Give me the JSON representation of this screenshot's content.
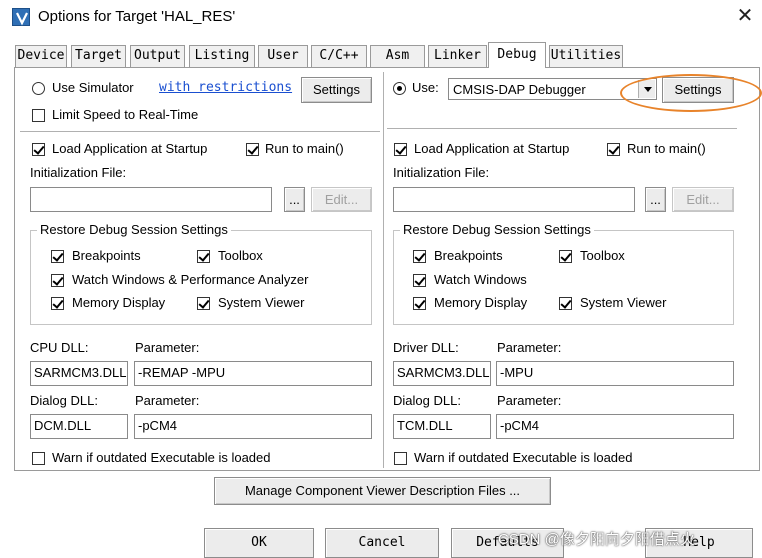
{
  "window": {
    "title": "Options for Target 'HAL_RES'",
    "close_glyph": "✕"
  },
  "tabs": [
    {
      "label": "Device",
      "active": false
    },
    {
      "label": "Target",
      "active": false
    },
    {
      "label": "Output",
      "active": false
    },
    {
      "label": "Listing",
      "active": false
    },
    {
      "label": "User",
      "active": false
    },
    {
      "label": "C/C++",
      "active": false
    },
    {
      "label": "Asm",
      "active": false
    },
    {
      "label": "Linker",
      "active": false
    },
    {
      "label": "Debug",
      "active": true
    },
    {
      "label": "Utilities",
      "active": false
    }
  ],
  "left": {
    "use_simulator_label": "Use Simulator",
    "use_simulator_selected": false,
    "restrictions_link": "with restrictions",
    "settings_label": "Settings",
    "limit_speed_label": "Limit Speed to Real-Time",
    "limit_speed_checked": false,
    "load_app_label": "Load Application at Startup",
    "load_app_checked": true,
    "run_to_main_label": "Run to main()",
    "run_to_main_checked": true,
    "init_file_label": "Initialization File:",
    "init_file_value": "",
    "browse_label": "...",
    "edit_label": "Edit...",
    "restore_group_title": "Restore Debug Session Settings",
    "breakpoints_label": "Breakpoints",
    "toolbox_label": "Toolbox",
    "watch_label": "Watch Windows & Performance Analyzer",
    "memory_label": "Memory Display",
    "sysviewer_label": "System Viewer",
    "dll_label": "CPU DLL:",
    "dll_param_label": "Parameter:",
    "dll_value": "SARMCM3.DLL",
    "dll_param_value": "-REMAP -MPU",
    "dialog_dll_label": "Dialog DLL:",
    "dialog_param_label": "Parameter:",
    "dialog_dll_value": "DCM.DLL",
    "dialog_param_value": "-pCM4",
    "warn_label": "Warn if outdated Executable is loaded",
    "warn_checked": false
  },
  "right": {
    "use_label": "Use:",
    "use_selected": true,
    "debugger_value": "CMSIS-DAP Debugger",
    "settings_label": "Settings",
    "load_app_label": "Load Application at Startup",
    "load_app_checked": true,
    "run_to_main_label": "Run to main()",
    "run_to_main_checked": true,
    "init_file_label": "Initialization File:",
    "init_file_value": "",
    "browse_label": "...",
    "edit_label": "Edit...",
    "restore_group_title": "Restore Debug Session Settings",
    "breakpoints_label": "Breakpoints",
    "toolbox_label": "Toolbox",
    "watch_label": "Watch Windows",
    "memory_label": "Memory Display",
    "sysviewer_label": "System Viewer",
    "dll_label": "Driver DLL:",
    "dll_param_label": "Parameter:",
    "dll_value": "SARMCM3.DLL",
    "dll_param_value": "-MPU",
    "dialog_dll_label": "Dialog DLL:",
    "dialog_param_label": "Parameter:",
    "dialog_dll_value": "TCM.DLL",
    "dialog_param_value": "-pCM4",
    "warn_label": "Warn if outdated Executable is loaded",
    "warn_checked": false
  },
  "manage_button_label": "Manage Component Viewer Description Files ...",
  "bottom_buttons": {
    "ok": "OK",
    "cancel": "Cancel",
    "defaults": "Defaults",
    "help": "Help"
  },
  "watermark": "CSDN @像夕阳向夕阳借点火",
  "colors": {
    "highlight": "#e8832a",
    "link": "#1a4fd0",
    "app_icon": "#2f6fb5"
  }
}
